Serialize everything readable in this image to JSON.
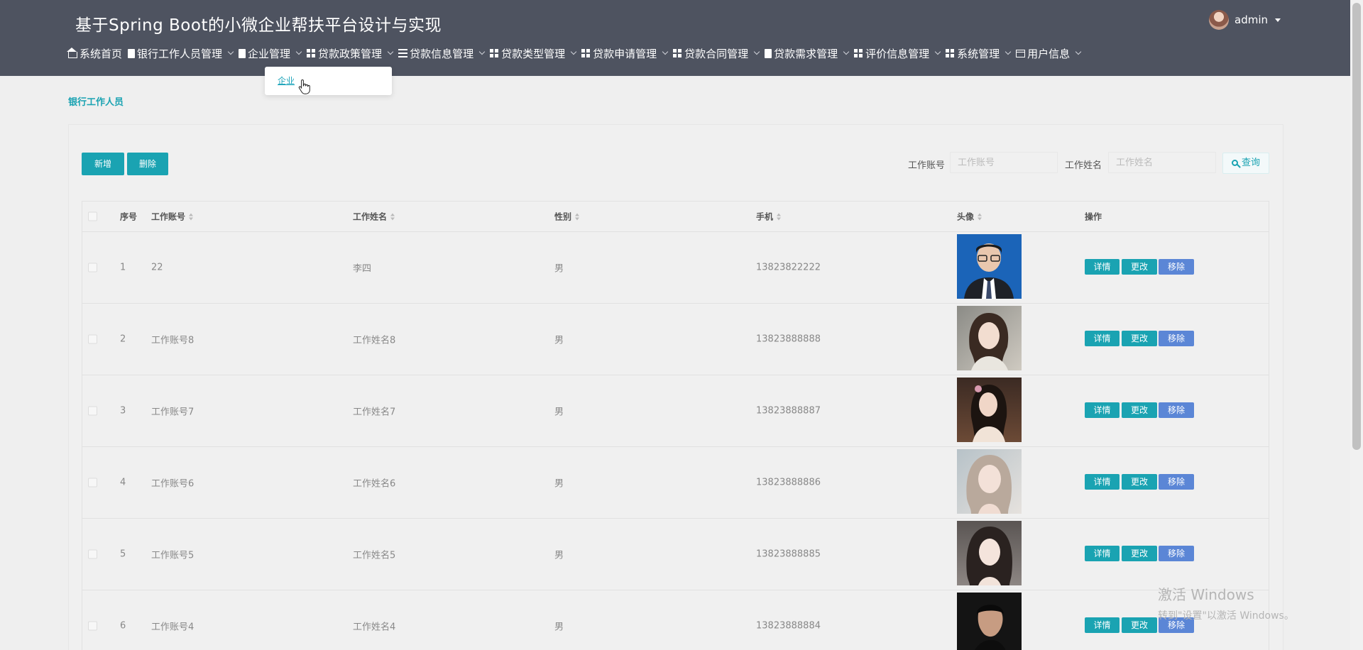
{
  "app": {
    "title": "基于Spring Boot的小微企业帮扶平台设计与实现"
  },
  "user": {
    "name": "admin"
  },
  "nav": [
    {
      "label": "系统首页",
      "icon": "home-icon"
    },
    {
      "label": "银行工作人员管理",
      "icon": "clipboard-icon"
    },
    {
      "label": "企业管理",
      "icon": "building-icon"
    },
    {
      "label": "贷款政策管理",
      "icon": "grid-icon"
    },
    {
      "label": "贷款信息管理",
      "icon": "list-icon"
    },
    {
      "label": "贷款类型管理",
      "icon": "grid-icon"
    },
    {
      "label": "贷款申请管理",
      "icon": "grid-icon"
    },
    {
      "label": "贷款合同管理",
      "icon": "grid-icon"
    },
    {
      "label": "贷款需求管理",
      "icon": "clipboard-icon"
    },
    {
      "label": "评价信息管理",
      "icon": "grid-icon"
    },
    {
      "label": "系统管理",
      "icon": "grid-icon"
    },
    {
      "label": "用户信息",
      "icon": "card-icon"
    }
  ],
  "dropdown": {
    "item": "企业"
  },
  "breadcrumb": "银行工作人员",
  "toolbar": {
    "add": "新增",
    "delete": "删除"
  },
  "search": {
    "account_label": "工作账号",
    "account_placeholder": "工作账号",
    "name_label": "工作姓名",
    "name_placeholder": "工作姓名",
    "button": "查询"
  },
  "table": {
    "headers": {
      "index": "序号",
      "account": "工作账号",
      "name": "工作姓名",
      "gender": "性别",
      "phone": "手机",
      "avatar": "头像",
      "ops": "操作"
    },
    "actions": {
      "detail": "详情",
      "edit": "更改",
      "remove": "移除"
    },
    "rows": [
      {
        "index": "1",
        "account": "22",
        "name": "李四",
        "gender": "男",
        "phone": "13823822222"
      },
      {
        "index": "2",
        "account": "工作账号8",
        "name": "工作姓名8",
        "gender": "男",
        "phone": "13823888888"
      },
      {
        "index": "3",
        "account": "工作账号7",
        "name": "工作姓名7",
        "gender": "男",
        "phone": "13823888887"
      },
      {
        "index": "4",
        "account": "工作账号6",
        "name": "工作姓名6",
        "gender": "男",
        "phone": "13823888886"
      },
      {
        "index": "5",
        "account": "工作账号5",
        "name": "工作姓名5",
        "gender": "男",
        "phone": "13823888885"
      },
      {
        "index": "6",
        "account": "工作账号4",
        "name": "工作姓名4",
        "gender": "男",
        "phone": "13823888884"
      }
    ]
  },
  "watermark": {
    "line1": "激活 Windows",
    "line2": "转到\"设置\"以激活 Windows。"
  },
  "colors": {
    "header_bg": "#4e5360",
    "accent": "#1aa3b2",
    "remove": "#5b86d6"
  }
}
